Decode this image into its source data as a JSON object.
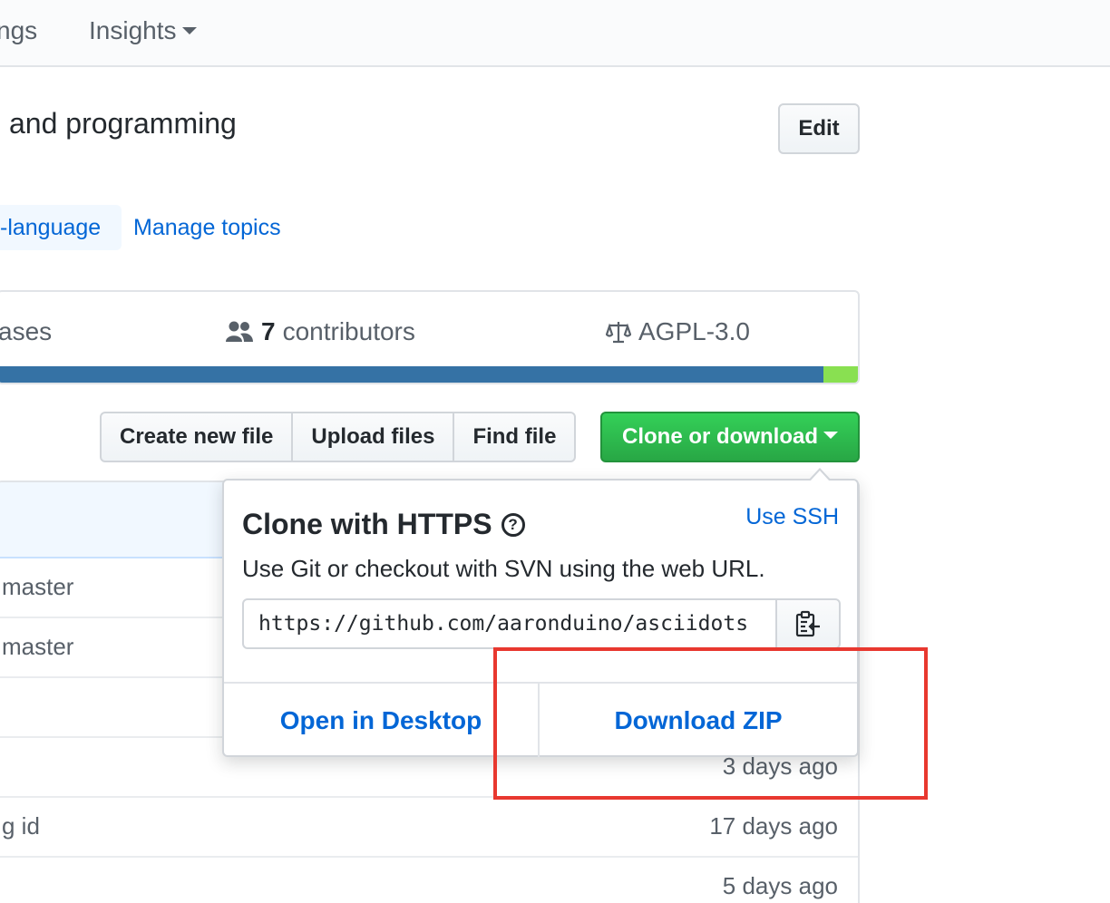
{
  "nav": {
    "settings_partial": "ngs",
    "insights": "Insights"
  },
  "repo": {
    "description_partial": "and programming",
    "edit_label": "Edit",
    "topic_partial": "-language",
    "manage_topics": "Manage topics"
  },
  "stats": {
    "releases_partial": "ases",
    "contributors_count": "7",
    "contributors_label": "contributors",
    "license": "AGPL-3.0"
  },
  "languages": [
    {
      "color": "#3572a5",
      "share": 0.957
    },
    {
      "color": "#89e051",
      "share": 0.043
    }
  ],
  "toolbar": {
    "create_new_file": "Create new file",
    "upload_files": "Upload files",
    "find_file": "Find file",
    "clone_or_download": "Clone or download"
  },
  "files": [
    {
      "text": "master",
      "age": ""
    },
    {
      "text": "master",
      "age": ""
    },
    {
      "text": "",
      "age": ""
    },
    {
      "text": "",
      "age": "3 days ago"
    },
    {
      "text": "g id",
      "age": "17 days ago"
    },
    {
      "text": "",
      "age": "5 days ago"
    }
  ],
  "clone_dropdown": {
    "title": "Clone with HTTPS",
    "use_ssh": "Use SSH",
    "subtitle": "Use Git or checkout with SVN using the web URL.",
    "url": "https://github.com/aaronduino/asciidots",
    "open_desktop": "Open in Desktop",
    "download_zip": "Download ZIP"
  },
  "colors": {
    "accent_blue": "#0366d6",
    "green_button": "#28a745",
    "highlight_red": "#e8382f"
  }
}
